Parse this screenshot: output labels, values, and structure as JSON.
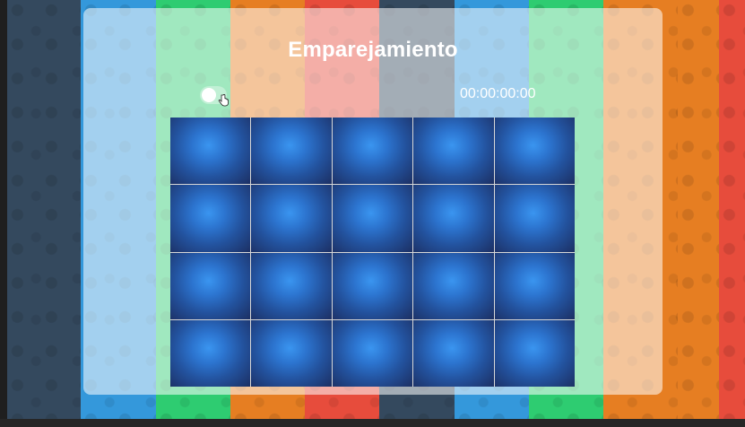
{
  "game": {
    "title": "Emparejamiento",
    "timer": "00:00:00:00",
    "toggle_on": false,
    "board": {
      "rows": 4,
      "columns": 5,
      "cards_face_down": 20
    }
  },
  "icons": {
    "toggle": "toggle-switch",
    "cursor": "hand-pointer-icon"
  },
  "colors": {
    "stripes": [
      "#34495e",
      "#3498db",
      "#2ecc71",
      "#e67e22",
      "#e74c3c",
      "#34495e",
      "#3498db",
      "#2ecc71",
      "#e67e22",
      "#e67e22",
      "#e74c3c"
    ],
    "card_center": "#3a95f0",
    "card_edge": "#1c2f63"
  }
}
